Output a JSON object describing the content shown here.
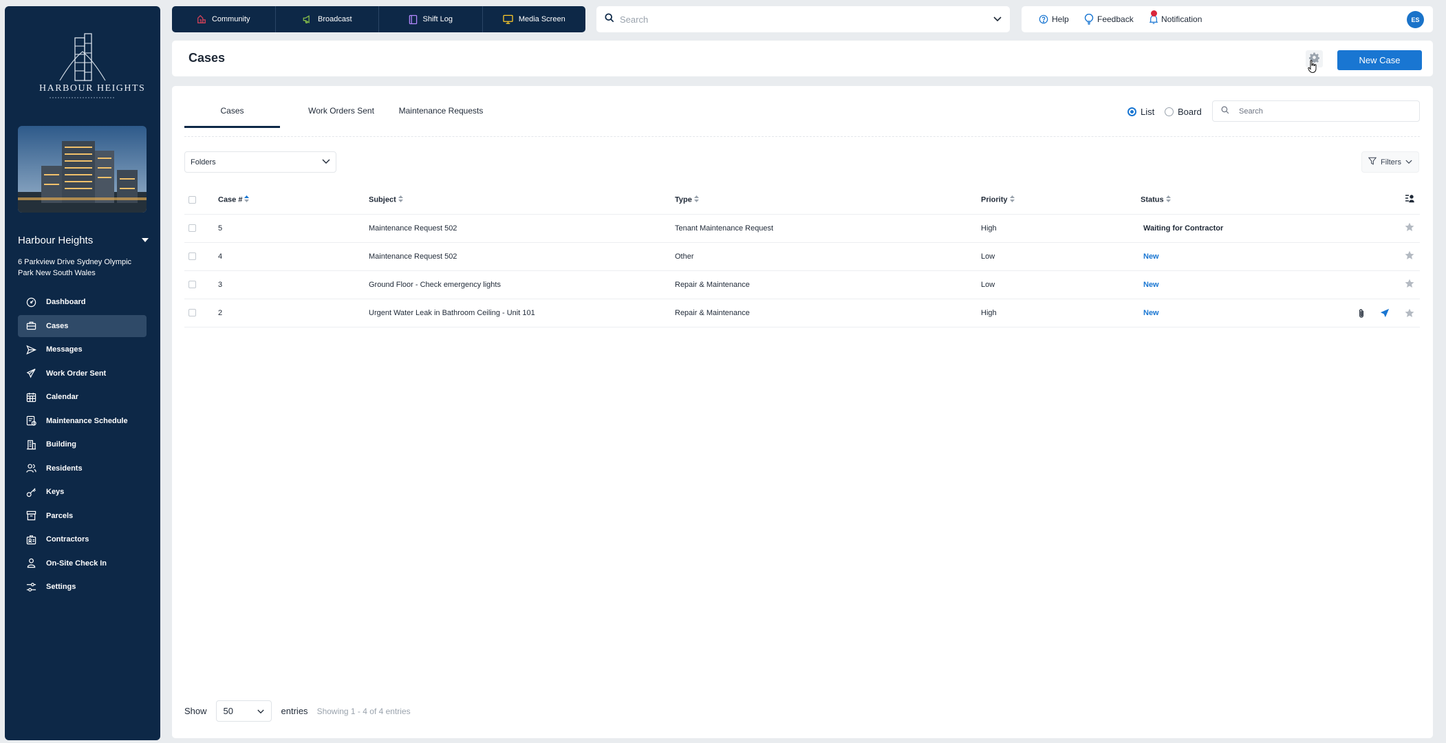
{
  "brand": {
    "logo_text": "HARBOUR HEIGHTS"
  },
  "property": {
    "name": "Harbour Heights",
    "address": "6 Parkview Drive Sydney Olympic Park New South Wales"
  },
  "sidebar": {
    "items": [
      {
        "label": "Dashboard",
        "icon": "dashboard-icon"
      },
      {
        "label": "Cases",
        "icon": "briefcase-icon"
      },
      {
        "label": "Messages",
        "icon": "send-icon"
      },
      {
        "label": "Work Order Sent",
        "icon": "megaphone-icon"
      },
      {
        "label": "Calendar",
        "icon": "calendar-icon"
      },
      {
        "label": "Maintenance Schedule",
        "icon": "schedule-icon"
      },
      {
        "label": "Building",
        "icon": "building-icon"
      },
      {
        "label": "Residents",
        "icon": "users-icon"
      },
      {
        "label": "Keys",
        "icon": "key-icon"
      },
      {
        "label": "Parcels",
        "icon": "parcel-icon"
      },
      {
        "label": "Contractors",
        "icon": "contractor-icon"
      },
      {
        "label": "On-Site Check In",
        "icon": "checkin-icon"
      },
      {
        "label": "Settings",
        "icon": "settings-sliders-icon"
      }
    ]
  },
  "quickbar": {
    "items": [
      {
        "label": "Community",
        "color": "#e0435a"
      },
      {
        "label": "Broadcast",
        "color": "#8bc34a"
      },
      {
        "label": "Shift Log",
        "color": "#b388ff"
      },
      {
        "label": "Media Screen",
        "color": "#ffca28"
      }
    ]
  },
  "search": {
    "placeholder": "Search"
  },
  "utility": {
    "help": "Help",
    "feedback": "Feedback",
    "notification": "Notification",
    "avatar": "ES"
  },
  "page": {
    "title": "Cases",
    "new_case_label": "New Case"
  },
  "tabs": [
    "Cases",
    "Work Orders Sent",
    "Maintenance Requests"
  ],
  "view": {
    "list": "List",
    "board": "Board",
    "search_placeholder": "Search"
  },
  "folders_label": "Folders",
  "filters_label": "Filters",
  "table": {
    "headers": {
      "case": "Case #",
      "subject": "Subject",
      "type": "Type",
      "priority": "Priority",
      "status": "Status"
    },
    "rows": [
      {
        "id": "5",
        "subject": "Maintenance Request 502",
        "type": "Tenant Maintenance Request",
        "priority": "High",
        "status": "Waiting for Contractor"
      },
      {
        "id": "4",
        "subject": "Maintenance Request 502",
        "type": "Other",
        "priority": "Low",
        "status": "New"
      },
      {
        "id": "3",
        "subject": "Ground Floor - Check emergency lights",
        "type": "Repair & Maintenance",
        "priority": "Low",
        "status": "New"
      },
      {
        "id": "2",
        "subject": "Urgent Water Leak in Bathroom Ceiling - Unit 101",
        "type": "Repair & Maintenance",
        "priority": "High",
        "status": "New"
      }
    ]
  },
  "footer": {
    "show": "Show",
    "page_size": "50",
    "entries": "entries",
    "showing": "Showing 1 - 4 of 4 entries"
  },
  "colors": {
    "sidebar_bg": "#0d2847",
    "accent": "#1976d2",
    "notif": "#d9263b"
  }
}
